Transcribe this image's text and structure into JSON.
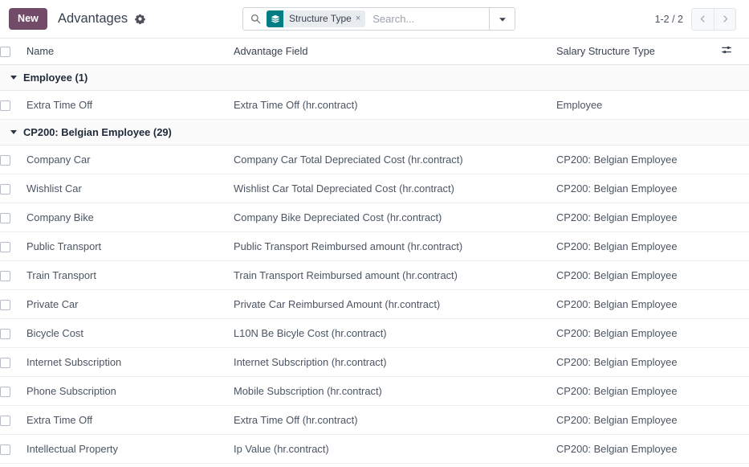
{
  "control_panel": {
    "new_button": "New",
    "breadcrumb_title": "Advantages",
    "gear_icon": "gear-icon",
    "search": {
      "search_icon": "search-icon",
      "facet": {
        "icon": "layers-stack-icon",
        "label": "Structure Type",
        "remove": "×",
        "icon_color": "#017e84"
      },
      "placeholder": "Search...",
      "toggle_icon": "caret-down-icon"
    },
    "pager": {
      "value": "1-2 / 2",
      "prev_icon": "chevron-left-icon",
      "next_icon": "chevron-right-icon"
    }
  },
  "list": {
    "columns": {
      "select_all": "select-all-checkbox",
      "name": "Name",
      "advantage_field": "Advantage Field",
      "salary_structure_type": "Salary Structure Type",
      "optional_toggle": "sliders-icon"
    },
    "groups": [
      {
        "label": "Employee (1)",
        "rows": [
          {
            "name": "Extra Time Off",
            "advantage_field": "Extra Time Off (hr.contract)",
            "salary_structure_type": "Employee"
          }
        ]
      },
      {
        "label": "CP200: Belgian Employee (29)",
        "rows": [
          {
            "name": "Company Car",
            "advantage_field": "Company Car Total Depreciated Cost (hr.contract)",
            "salary_structure_type": "CP200: Belgian Employee"
          },
          {
            "name": "Wishlist Car",
            "advantage_field": "Wishlist Car Total Depreciated Cost (hr.contract)",
            "salary_structure_type": "CP200: Belgian Employee"
          },
          {
            "name": "Company Bike",
            "advantage_field": "Company Bike Depreciated Cost (hr.contract)",
            "salary_structure_type": "CP200: Belgian Employee"
          },
          {
            "name": "Public Transport",
            "advantage_field": "Public Transport Reimbursed amount (hr.contract)",
            "salary_structure_type": "CP200: Belgian Employee"
          },
          {
            "name": "Train Transport",
            "advantage_field": "Train Transport Reimbursed amount (hr.contract)",
            "salary_structure_type": "CP200: Belgian Employee"
          },
          {
            "name": "Private Car",
            "advantage_field": "Private Car Reimbursed Amount (hr.contract)",
            "salary_structure_type": "CP200: Belgian Employee"
          },
          {
            "name": "Bicycle Cost",
            "advantage_field": "L10N Be Bicyle Cost (hr.contract)",
            "salary_structure_type": "CP200: Belgian Employee"
          },
          {
            "name": "Internet Subscription",
            "advantage_field": "Internet Subscription (hr.contract)",
            "salary_structure_type": "CP200: Belgian Employee"
          },
          {
            "name": "Phone Subscription",
            "advantage_field": "Mobile Subscription (hr.contract)",
            "salary_structure_type": "CP200: Belgian Employee"
          },
          {
            "name": "Extra Time Off",
            "advantage_field": "Extra Time Off (hr.contract)",
            "salary_structure_type": "CP200: Belgian Employee"
          },
          {
            "name": "Intellectual Property",
            "advantage_field": "Ip Value (hr.contract)",
            "salary_structure_type": "CP200: Belgian Employee"
          }
        ]
      }
    ]
  },
  "colors": {
    "brand_purple": "#714B67",
    "facet_teal": "#017e84",
    "text_default": "#4b5563",
    "group_text": "#1f2937"
  }
}
